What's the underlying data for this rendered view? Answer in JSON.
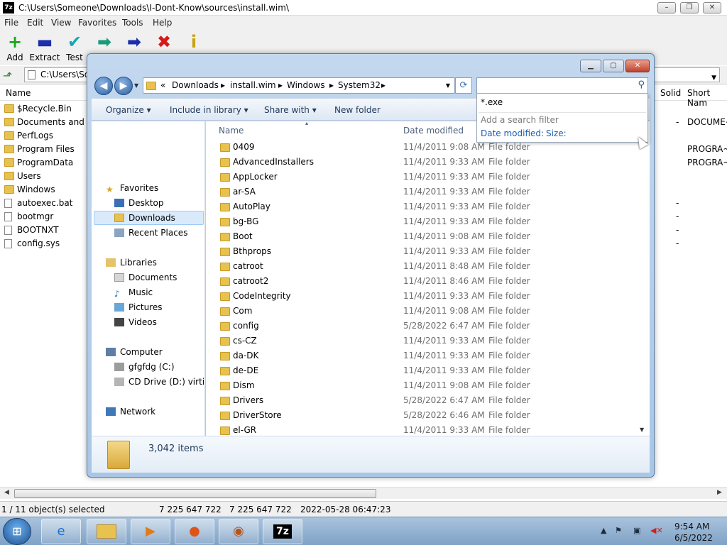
{
  "sevenzip": {
    "title": "C:\\Users\\Someone\\Downloads\\I-Dont-Know\\sources\\install.wim\\",
    "logo": "7z",
    "window_buttons": {
      "minimize": "–",
      "maximize": "❐",
      "close": "✕"
    },
    "menu": [
      "File",
      "Edit",
      "View",
      "Favorites",
      "Tools",
      "Help"
    ],
    "toolbar": [
      {
        "label": "Add",
        "icon": "+",
        "color": "#1aa51a"
      },
      {
        "label": "Extract",
        "icon": "▬",
        "color": "#1c2ea8"
      },
      {
        "label": "Test",
        "icon": "✔",
        "color": "#1aa5b0"
      },
      {
        "label": "",
        "icon": "➡",
        "color": "#1b9a7a"
      },
      {
        "label": "",
        "icon": "➡",
        "color": "#1c2ea8"
      },
      {
        "label": "",
        "icon": "✖",
        "color": "#d61a1a"
      },
      {
        "label": "",
        "icon": "i",
        "color": "#c8a21a"
      }
    ],
    "address": "C:\\Users\\Som",
    "columns": {
      "name": "Name",
      "solid": "Solid",
      "short_name": "Short Nam"
    },
    "rows": [
      {
        "name": "$Recycle.Bin",
        "type": "folder",
        "c1": "",
        "c2": ""
      },
      {
        "name": "Documents and Se",
        "type": "folder",
        "c1": "-",
        "c2": "DOCUME~"
      },
      {
        "name": "PerfLogs",
        "type": "folder",
        "c1": "",
        "c2": ""
      },
      {
        "name": "Program Files",
        "type": "folder",
        "c1": "",
        "c2": "PROGRA~"
      },
      {
        "name": "ProgramData",
        "type": "folder",
        "c1": "",
        "c2": "PROGRA~"
      },
      {
        "name": "Users",
        "type": "folder",
        "c1": "",
        "c2": ""
      },
      {
        "name": "Windows",
        "type": "folder",
        "c1": "",
        "c2": ""
      },
      {
        "name": "autoexec.bat",
        "type": "file",
        "c1": "-",
        "c2": ""
      },
      {
        "name": "bootmgr",
        "type": "file",
        "c1": "-",
        "c2": ""
      },
      {
        "name": "BOOTNXT",
        "type": "file",
        "c1": "-",
        "c2": ""
      },
      {
        "name": "config.sys",
        "type": "file",
        "c1": "-",
        "c2": ""
      }
    ],
    "status": {
      "selection": "1 / 11 object(s) selected",
      "size": "7 225 647 722",
      "packed": "7 225 647 722",
      "modified": "2022-05-28 06:47:23"
    }
  },
  "explorer": {
    "window_buttons": {
      "minimize": "▁",
      "maximize": "▢",
      "close": "✕"
    },
    "breadcrumb": [
      "«",
      "Downloads",
      "install.wim",
      "Windows",
      "System32"
    ],
    "search_placeholder": "",
    "commands": [
      "Organize ▾",
      "Include in library ▾",
      "Share with ▾",
      "New folder"
    ],
    "nav": {
      "favorites": "Favorites",
      "desktop": "Desktop",
      "downloads": "Downloads",
      "recent": "Recent Places",
      "libraries": "Libraries",
      "documents": "Documents",
      "music": "Music",
      "pictures": "Pictures",
      "videos": "Videos",
      "computer": "Computer",
      "drive_c": "gfgfdg (C:)",
      "drive_d": "CD Drive (D:) virtio-w",
      "network": "Network"
    },
    "headers": {
      "name": "Name",
      "date": "Date modified"
    },
    "files": [
      {
        "name": "0409",
        "date": "11/4/2011 9:08 AM",
        "type": "File folder"
      },
      {
        "name": "AdvancedInstallers",
        "date": "11/4/2011 9:33 AM",
        "type": "File folder"
      },
      {
        "name": "AppLocker",
        "date": "11/4/2011 9:33 AM",
        "type": "File folder"
      },
      {
        "name": "ar-SA",
        "date": "11/4/2011 9:33 AM",
        "type": "File folder"
      },
      {
        "name": "AutoPlay",
        "date": "11/4/2011 9:33 AM",
        "type": "File folder"
      },
      {
        "name": "bg-BG",
        "date": "11/4/2011 9:33 AM",
        "type": "File folder"
      },
      {
        "name": "Boot",
        "date": "11/4/2011 9:08 AM",
        "type": "File folder"
      },
      {
        "name": "Bthprops",
        "date": "11/4/2011 9:33 AM",
        "type": "File folder"
      },
      {
        "name": "catroot",
        "date": "11/4/2011 8:48 AM",
        "type": "File folder"
      },
      {
        "name": "catroot2",
        "date": "11/4/2011 8:46 AM",
        "type": "File folder"
      },
      {
        "name": "CodeIntegrity",
        "date": "11/4/2011 9:33 AM",
        "type": "File folder"
      },
      {
        "name": "Com",
        "date": "11/4/2011 9:08 AM",
        "type": "File folder"
      },
      {
        "name": "config",
        "date": "5/28/2022 6:47 AM",
        "type": "File folder"
      },
      {
        "name": "cs-CZ",
        "date": "11/4/2011 9:33 AM",
        "type": "File folder"
      },
      {
        "name": "da-DK",
        "date": "11/4/2011 9:33 AM",
        "type": "File folder"
      },
      {
        "name": "de-DE",
        "date": "11/4/2011 9:33 AM",
        "type": "File folder"
      },
      {
        "name": "Dism",
        "date": "11/4/2011 9:08 AM",
        "type": "File folder"
      },
      {
        "name": "Drivers",
        "date": "5/28/2022 6:47 AM",
        "type": "File folder"
      },
      {
        "name": "DriverStore",
        "date": "5/28/2022 6:46 AM",
        "type": "File folder"
      },
      {
        "name": "el-GR",
        "date": "11/4/2011 9:33 AM",
        "type": "File folder"
      }
    ],
    "item_count": "3,042 items",
    "suggest": {
      "entry": "*.exe",
      "filter_label": "Add a search filter",
      "date_filter": "Date modified:",
      "size_filter": "Size:"
    }
  },
  "taskbar": {
    "start_icon": "⊞",
    "clock_time": "9:54 AM",
    "clock_date": "6/5/2022"
  }
}
